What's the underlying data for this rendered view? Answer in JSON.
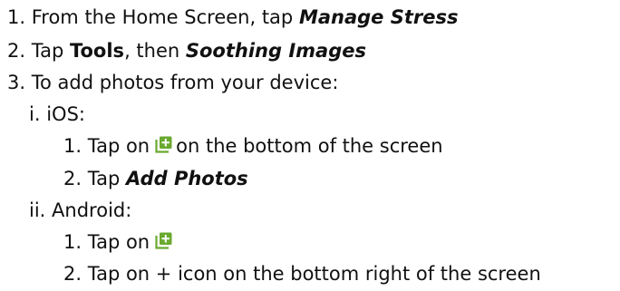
{
  "items": [
    {
      "num": "1.",
      "pre": "From the Home Screen, tap ",
      "em": "Manage Stress"
    },
    {
      "num": "2.",
      "pre": "Tap ",
      "bold": "Tools",
      "mid": ", then ",
      "em": "Soothing Images"
    },
    {
      "num": "3.",
      "text": "To add photos from your device:"
    },
    {
      "num": "i.",
      "text": "iOS:"
    },
    {
      "num": "1.",
      "pre": "Tap on",
      "post": "on the bottom of the screen"
    },
    {
      "num": "2.",
      "pre": "Tap ",
      "em": "Add Photos"
    },
    {
      "num": "ii.",
      "text": "Android:"
    },
    {
      "num": "1.",
      "pre": "Tap on"
    },
    {
      "num": "2.",
      "text": "Tap on + icon on the bottom right of the screen"
    }
  ],
  "icons": {
    "add_photo": "add-photo-icon"
  },
  "colors": {
    "icon_green": "#6aa92f",
    "text": "#111111"
  }
}
